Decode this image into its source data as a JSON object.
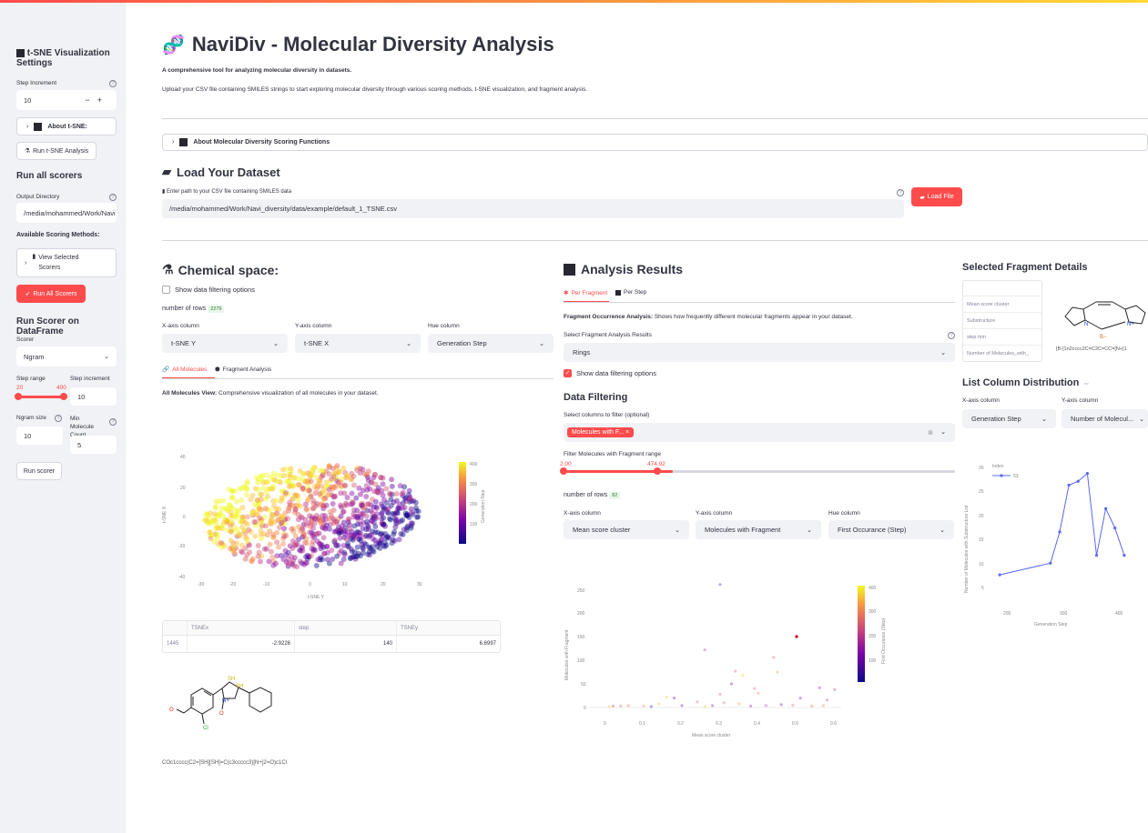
{
  "sidebar": {
    "tsne_title": "t-SNE Visualization Settings",
    "step_increment_label": "Step Increment",
    "step_increment_value": "10",
    "about_tsne": "About t-SNE:",
    "run_tsne": "Run t-SNE Analysis",
    "run_all_title": "Run all scorers",
    "output_dir_label": "Output Directory",
    "output_dir_value": "/media/mohammed/Work/Navi",
    "available_methods": "Available Scoring Methods:",
    "view_selected": "View Selected Scorers",
    "run_all_btn": "Run All Scorers",
    "run_scorer_title": "Run Scorer on DataFrame",
    "scorer_label": "Scorer",
    "scorer_value": "Ngram",
    "step_range_label": "Step range",
    "step_range_min": "20",
    "step_range_max": "400",
    "step_inc2_label": "Step increment",
    "step_inc2_value": "10",
    "ngram_size_label": "Ngram size",
    "ngram_size_value": "10",
    "min_mol_label": "Min Molecule Count",
    "min_mol_value": "5",
    "run_scorer_btn": "Run scorer"
  },
  "header": {
    "title": "NaviDiv - Molecular Diversity Analysis",
    "subtitle": "A comprehensive tool for analyzing molecular diversity in datasets.",
    "intro": "Upload your CSV file containing SMILES strings to start exploring molecular diversity through various scoring methods, t-SNE visualization, and fragment analysis.",
    "about_scoring": "About Molecular Diversity Scoring Functions"
  },
  "load": {
    "title": "Load Your Dataset",
    "path_label": "Enter path to your CSV file containing SMILES data",
    "path_value": "/media/mohammed/Work/Navi_diversity/data/example/default_1_TSNE.csv",
    "load_btn": "Load File"
  },
  "chem": {
    "title": "Chemical space:",
    "show_filter": "Show data filtering options",
    "rows_label": "number of rows",
    "rows_value": "2279",
    "x_label": "X-axis column",
    "x_value": "t-SNE Y",
    "y_label": "Y-axis column",
    "y_value": "t-SNE X",
    "hue_label": "Hue column",
    "hue_value": "Generation Step",
    "tab_all": "All Molecules",
    "tab_frag": "Fragment Analysis",
    "view_bold": "All Molecules View:",
    "view_text": "Comprehensive visualization of all molecules in your dataset.",
    "table_headers": [
      "",
      "TSNEx",
      "step",
      "TSNEy"
    ],
    "table_row": [
      "1445",
      "-2.9226",
      "140",
      "6.6997"
    ],
    "smiles": "COc1cccc(C2=[SH][SH]=C(c3ccccc3)[N+]2=O)c1Cl"
  },
  "analysis": {
    "title": "Analysis Results",
    "tab_fragment": "Per Fragment",
    "tab_step": "Per Step",
    "occ_bold": "Fragment Occurrence Analysis:",
    "occ_text": "Shows how frequently different molecular fragments appear in your dataset.",
    "select_label": "Select Fragment Analysis Results",
    "select_value": "Rings",
    "show_filter": "Show data filtering options",
    "filter_title": "Data Filtering",
    "filter_cols_label": "Select columns to filter (optional)",
    "filter_tag": "Molecules with F...",
    "range_label": "Filter Molecules with Fragment range",
    "range_min": "2.00",
    "range_max": "474.92",
    "rows_label": "number of rows",
    "rows_value": "82",
    "x_label": "X-axis column",
    "x_value": "Mean score cluster",
    "y_label": "Y-axis column",
    "y_value": "Molecules with Fragment",
    "hue_label": "Hue column",
    "hue_value": "First Occurance (Step)"
  },
  "fragment": {
    "title": "Selected Fragment Details",
    "rows": [
      "Mean score cluster",
      "Substructure",
      "step min",
      "Number of Molecules_with_"
    ],
    "smiles": "[B-]1n2cccc2C=C2C=CC=[N+]1"
  },
  "listdist": {
    "title": "List Column Distribution",
    "x_label": "X-axis column",
    "x_value": "Generation Step",
    "y_label": "Y-axis column",
    "y_value": "Number of Molecul..."
  },
  "tsne_chart": {
    "xlabel": "t-SNE Y",
    "ylabel": "t-SNE X",
    "colorbar_label": "Generation Step",
    "xticks": [
      "-30",
      "-20",
      "-10",
      "0",
      "10",
      "20",
      "30"
    ],
    "yticks": [
      "40",
      "20",
      "0",
      "-20",
      "-40"
    ],
    "cticks": [
      "400",
      "300",
      "200",
      "100"
    ]
  },
  "scatter_chart": {
    "xlabel": "Mean score cluster",
    "ylabel": "Molecules with Fragment",
    "colorbar_label": "First Occurance (Step)",
    "xticks": [
      "0",
      "0.1",
      "0.2",
      "0.3",
      "0.4",
      "0.5",
      "0.6"
    ],
    "yticks": [
      "250",
      "200",
      "150",
      "100",
      "50",
      "0"
    ],
    "cticks": [
      "400",
      "300",
      "200",
      "100"
    ]
  },
  "chart_data": [
    {
      "type": "scatter",
      "xlabel": "t-SNE Y",
      "ylabel": "t-SNE X",
      "xlim": [
        -35,
        35
      ],
      "ylim": [
        -42,
        42
      ],
      "hue": "Generation Step",
      "description_points": "dense cloud of ~2279 points spanning x -28..28, y -28..30"
    },
    {
      "type": "scatter",
      "xlabel": "Mean score cluster",
      "ylabel": "Molecules with Fragment",
      "xlim": [
        -0.03,
        0.62
      ],
      "ylim": [
        -10,
        265
      ],
      "points": [
        {
          "x": 0.3,
          "y": 260
        },
        {
          "x": 0.5,
          "y": 150
        },
        {
          "x": 0.26,
          "y": 122
        },
        {
          "x": 0.44,
          "y": 106
        },
        {
          "x": 0.34,
          "y": 77
        },
        {
          "x": 0.45,
          "y": 75
        },
        {
          "x": 0.36,
          "y": 68
        },
        {
          "x": 0.33,
          "y": 50
        },
        {
          "x": 0.56,
          "y": 42
        },
        {
          "x": 0.6,
          "y": 38
        },
        {
          "x": 0.39,
          "y": 40
        },
        {
          "x": 0.3,
          "y": 28
        },
        {
          "x": 0.4,
          "y": 30
        },
        {
          "x": 0.16,
          "y": 22
        },
        {
          "x": 0.18,
          "y": 20
        },
        {
          "x": 0.51,
          "y": 20
        },
        {
          "x": 0.58,
          "y": 16
        },
        {
          "x": 0.24,
          "y": 12
        },
        {
          "x": 0.31,
          "y": 10
        },
        {
          "x": 0.35,
          "y": 8
        },
        {
          "x": 0.14,
          "y": 8
        },
        {
          "x": 0.46,
          "y": 6
        },
        {
          "x": 0.28,
          "y": 4
        },
        {
          "x": 0.02,
          "y": 3
        },
        {
          "x": 0.04,
          "y": 3
        },
        {
          "x": 0.06,
          "y": 4
        },
        {
          "x": 0.1,
          "y": 3
        },
        {
          "x": 0.01,
          "y": 2
        },
        {
          "x": 0.2,
          "y": 4
        },
        {
          "x": 0.38,
          "y": 3
        },
        {
          "x": 0.42,
          "y": 4
        },
        {
          "x": 0.49,
          "y": 5
        },
        {
          "x": 0.54,
          "y": 3
        },
        {
          "x": 0.57,
          "y": 4
        },
        {
          "x": 0.26,
          "y": 2
        },
        {
          "x": 0.12,
          "y": 2
        }
      ],
      "hue": "First Occurance (Step)"
    },
    {
      "type": "line",
      "xlabel": "Generation Step",
      "ylabel": "Number of Molecules with Substructure List",
      "series": [
        {
          "name": "53",
          "x": [
            140,
            250,
            270,
            290,
            310,
            330,
            350,
            370,
            390,
            410
          ],
          "values": [
            3,
            6,
            14,
            26,
            27,
            29,
            8,
            20,
            15,
            8
          ]
        }
      ],
      "legend_title": "Index",
      "xticks": [
        "200",
        "300",
        "400"
      ],
      "yticks": [
        "30",
        "25",
        "20",
        "15",
        "10",
        "5"
      ],
      "xlim": [
        120,
        430
      ],
      "ylim": [
        0,
        31
      ]
    }
  ]
}
